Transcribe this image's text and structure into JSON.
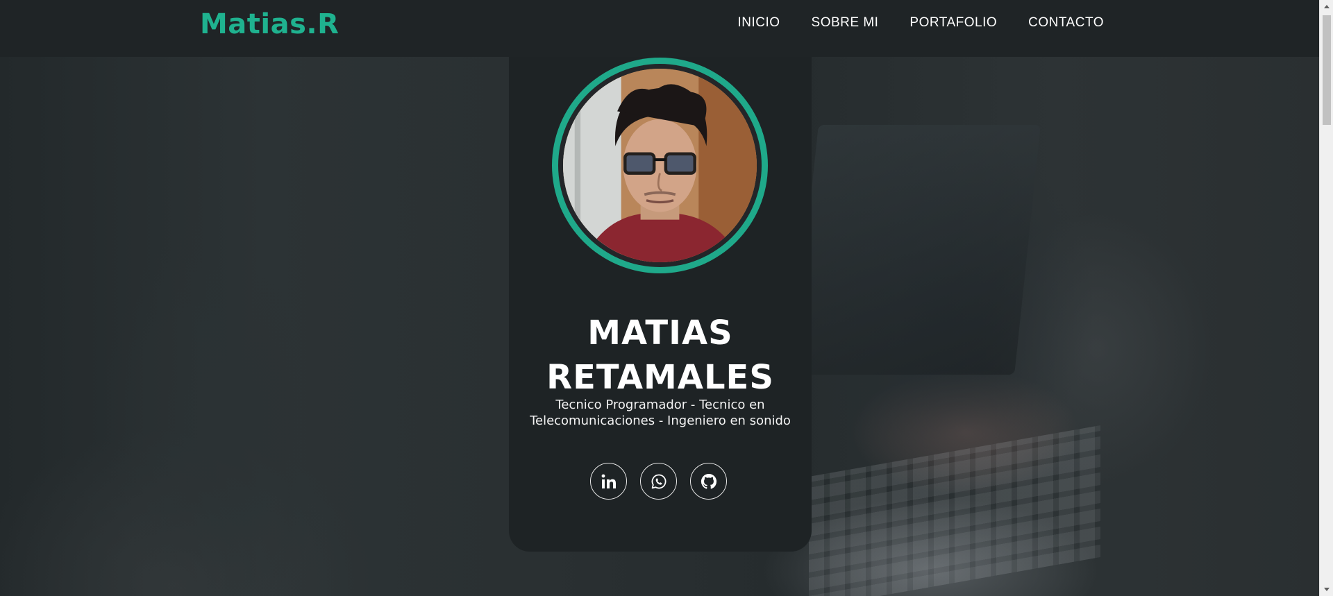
{
  "header": {
    "logo": "Matias.R",
    "nav": [
      {
        "label": "INICIO"
      },
      {
        "label": "SOBRE MI"
      },
      {
        "label": "PORTAFOLIO"
      },
      {
        "label": "CONTACTO"
      }
    ]
  },
  "profile": {
    "name_line1": "MATIAS",
    "name_line2": "RETAMALES",
    "subtitle_line1": "Tecnico Programador - Tecnico en",
    "subtitle_line2": "Telecomunicaciones - Ingeniero en sonido",
    "socials": [
      {
        "icon": "linkedin-icon"
      },
      {
        "icon": "whatsapp-icon"
      },
      {
        "icon": "github-icon"
      }
    ]
  },
  "colors": {
    "accent": "#1fb28f",
    "header_bg": "#1f2426",
    "card_bg": "#1e2325"
  }
}
